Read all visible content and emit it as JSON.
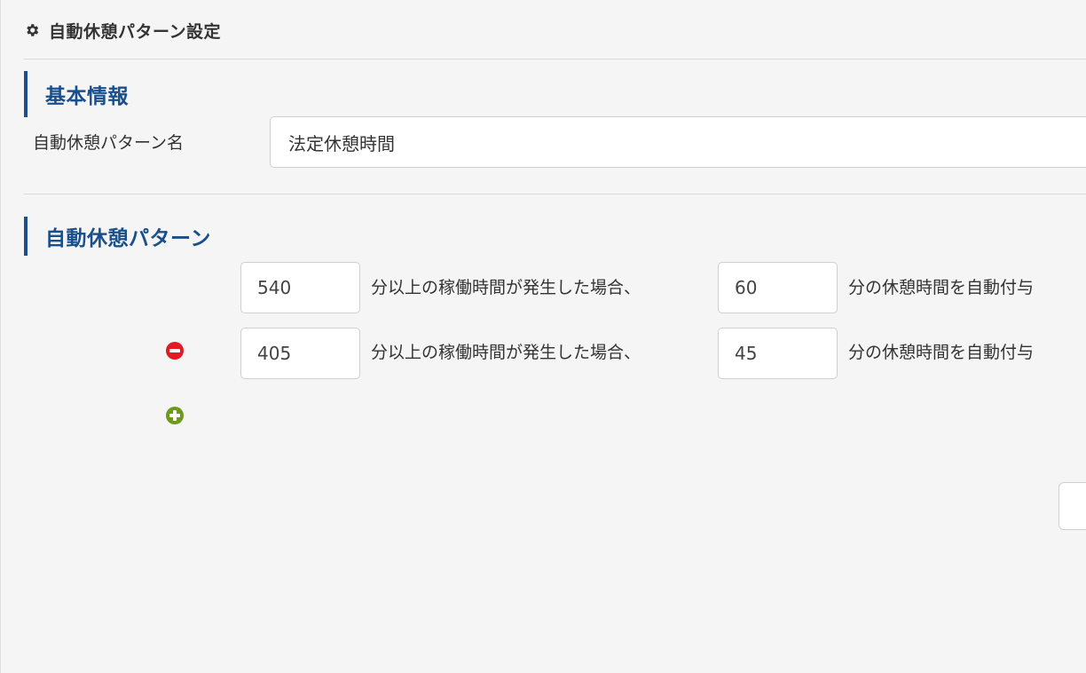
{
  "page": {
    "title": "自動休憩パターン設定",
    "icon": "gear-icon"
  },
  "basic_info": {
    "heading": "基本情報",
    "pattern_name_label": "自動休憩パターン名",
    "pattern_name_value": "法定休憩時間"
  },
  "auto_break": {
    "heading": "自動休憩パターン",
    "rows": [
      {
        "work_minutes": "540",
        "mid_text": "分以上の稼働時間が発生した場合、",
        "break_minutes": "60",
        "end_text": "分の休憩時間を自動付与"
      },
      {
        "work_minutes": "405",
        "mid_text": "分以上の稼働時間が発生した場合、",
        "break_minutes": "45",
        "end_text": "分の休憩時間を自動付与",
        "remove_icon": "remove-circle-icon"
      }
    ],
    "add_icon": "add-circle-icon",
    "accent_color": "#1a4f8b",
    "remove_color": "#e01b24",
    "add_color": "#6b9a1c"
  }
}
